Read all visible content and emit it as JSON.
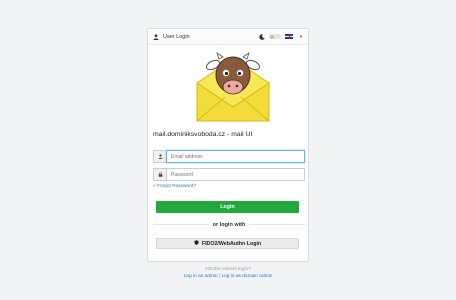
{
  "header": {
    "title": "User Login",
    "icons": [
      "user-icon",
      "moon-icon",
      "theme-toggle",
      "uk-flag-icon",
      "caret-down-icon"
    ]
  },
  "brand": {
    "title": "mail.dominiksvoboda.cz - mail UI"
  },
  "form": {
    "email_placeholder": "Email address",
    "password_placeholder": "Password",
    "forgot_label": "« Forgot Password?",
    "login_label": "Login"
  },
  "separator": {
    "label": "or login with"
  },
  "fido": {
    "label": "FIDO2/WebAuthn Login"
  },
  "footer": {
    "question": "Not the correct login?",
    "admin_link": "Log in as admin",
    "separator": "|",
    "domain_admin_link": "Log in as domain admin"
  },
  "colors": {
    "primary": "#22a93d",
    "link": "#2a6fd6",
    "focus": "#66afe9"
  }
}
